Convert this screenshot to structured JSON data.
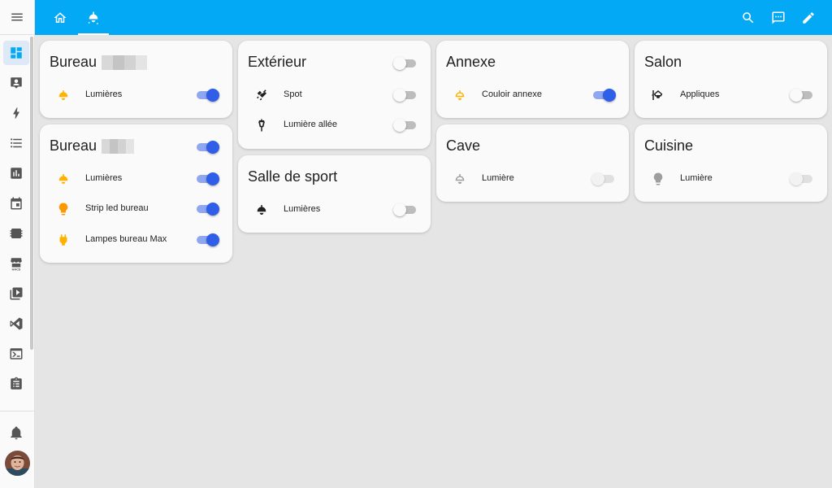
{
  "colors": {
    "header": "#03a9f4",
    "toggle_on": "#2f5fe8",
    "icon_on": "#ffb300",
    "icon_off": "#212121"
  },
  "sidebar": {
    "menu_icon": "menu-icon",
    "items": [
      {
        "name": "overview",
        "icon": "dashboard-icon",
        "active": true
      },
      {
        "name": "map",
        "icon": "account-box-icon"
      },
      {
        "name": "energy",
        "icon": "lightning-bolt-icon"
      },
      {
        "name": "logbook",
        "icon": "format-list-icon"
      },
      {
        "name": "history",
        "icon": "chart-box-icon"
      },
      {
        "name": "calendar",
        "icon": "calendar-icon"
      },
      {
        "name": "esphome",
        "icon": "chip-icon"
      },
      {
        "name": "hacs",
        "icon": "hacs-store-icon",
        "badge": "HACS"
      },
      {
        "name": "media",
        "icon": "play-box-icon"
      },
      {
        "name": "vscode",
        "icon": "code-editor-icon"
      },
      {
        "name": "terminal",
        "icon": "console-icon"
      },
      {
        "name": "todo",
        "icon": "clipboard-list-icon"
      }
    ],
    "notifications_icon": "bell-icon"
  },
  "header": {
    "tabs": [
      {
        "name": "home",
        "icon": "home-icon"
      },
      {
        "name": "lights",
        "icon": "ceiling-light-icon",
        "active": true
      }
    ],
    "actions": [
      "search-icon",
      "assist-icon",
      "pencil-icon"
    ]
  },
  "cards": {
    "bureau1": {
      "title": "Bureau",
      "rows": [
        {
          "label": "Lumières",
          "on": true
        }
      ]
    },
    "bureau2": {
      "title": "Bureau",
      "header_on": true,
      "rows": [
        {
          "label": "Lumières",
          "on": true
        },
        {
          "label": "Strip led bureau",
          "on": true
        },
        {
          "label": "Lampes bureau Max",
          "on": true
        }
      ]
    },
    "exterieur": {
      "title": "Extérieur",
      "header_on": false,
      "rows": [
        {
          "label": "Spot",
          "on": false
        },
        {
          "label": "Lumière allée",
          "on": false
        }
      ]
    },
    "sport": {
      "title": "Salle de sport",
      "rows": [
        {
          "label": "Lumières",
          "on": false
        }
      ]
    },
    "annexe": {
      "title": "Annexe",
      "rows": [
        {
          "label": "Couloir annexe",
          "on": true
        }
      ]
    },
    "cave": {
      "title": "Cave",
      "rows": [
        {
          "label": "Lumière",
          "on": false,
          "unavailable": true
        }
      ]
    },
    "salon": {
      "title": "Salon",
      "rows": [
        {
          "label": "Appliques",
          "on": false
        }
      ]
    },
    "cuisine": {
      "title": "Cuisine",
      "rows": [
        {
          "label": "Lumière",
          "on": false,
          "unavailable": true
        }
      ]
    }
  }
}
